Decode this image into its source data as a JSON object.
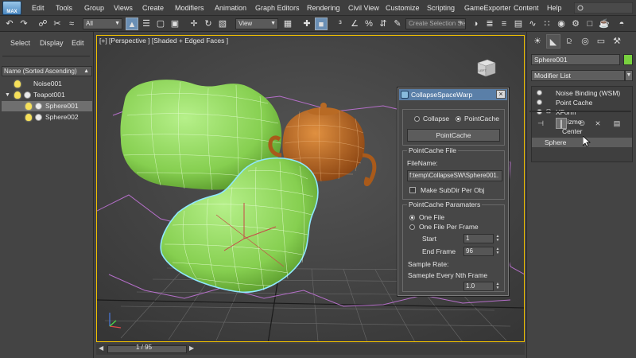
{
  "app": {
    "logo_text": "MAX"
  },
  "menu": [
    "Edit",
    "Tools",
    "Group",
    "Views",
    "Create",
    "Modifiers",
    "Animation",
    "Graph Editors",
    "Rendering",
    "Civil View",
    "Customize",
    "Scripting",
    "GameExporter",
    "Content",
    "Help"
  ],
  "toolbar": {
    "selection_filter": "All",
    "ref_coord": "View",
    "named_selection_placeholder": "Create Selection Set"
  },
  "explorer": {
    "tabs": [
      "Select",
      "Display",
      "Edit"
    ],
    "sort_header": "Name (Sorted Ascending)",
    "items": [
      {
        "name": "Noise001"
      },
      {
        "name": "Teapot001"
      },
      {
        "name": "Sphere001"
      },
      {
        "name": "Sphere002"
      }
    ]
  },
  "viewport": {
    "label": "[+] [Perspective ] [Shaded + Edged Faces ]",
    "viewcube_face": "LEFT"
  },
  "dialog": {
    "title": "CollapseSpaceWarp",
    "options": [
      "Collapse",
      "PointCache"
    ],
    "selected_option": "PointCache",
    "action_button": "PointCache",
    "file_group": {
      "title": "PointCache File",
      "filename_label": "FileName:",
      "filename_value": "f:temp\\CollapseSW\\Sphere001.",
      "subdir_label": "Make SubDir Per Obj",
      "subdir_checked": false
    },
    "params_group": {
      "title": "PointCache Paramaters",
      "mode_options": [
        "One File",
        "One File Per Frame"
      ],
      "selected_mode": "One File",
      "start_label": "Start",
      "start_value": "1",
      "end_label": "End Frame",
      "end_value": "96",
      "sample_rate_label": "Sample Rate:",
      "sample_every_label": "Sameple Every Nth Frame",
      "sample_every_value": "1.0"
    }
  },
  "timeline": {
    "frame_label": "1 / 95"
  },
  "command_panel": {
    "object_name": "Sphere001",
    "object_color": "#79d13f",
    "modifier_list": "Modifier List",
    "stack": [
      "Noise Binding (WSM)",
      "Point Cache",
      "XForm",
      "Gizmo",
      "Center",
      "Sphere"
    ]
  },
  "colors": {
    "viewport_border": "#f0c000",
    "mesh_green": "#8fd65a",
    "teapot_orange": "#c86a1e",
    "selection_cyan": "#8ee8ff",
    "noise_gizmo": "#b56fc9"
  }
}
